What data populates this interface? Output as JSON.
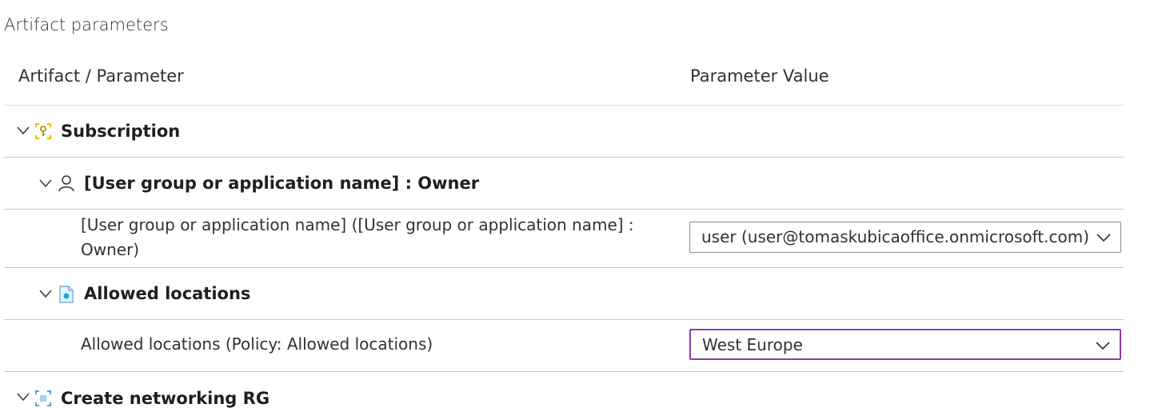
{
  "section": {
    "title": "Artifact parameters"
  },
  "table": {
    "col_artifact": "Artifact / Parameter",
    "col_value": "Parameter Value"
  },
  "groups": [
    {
      "label": "Subscription",
      "icon": "subscription-key-icon"
    },
    {
      "label": "[User group or application name] : Owner",
      "icon": "user-icon"
    },
    {
      "label": "Allowed locations",
      "icon": "policy-icon"
    },
    {
      "label": "Create networking RG",
      "icon": "resource-group-icon"
    }
  ],
  "params": [
    {
      "label": "[User group or application name] ([User group or application name] : Owner)",
      "value": "user (user@tomaskubicaoffice.onmicrosoft.com)"
    },
    {
      "label": "Allowed locations (Policy: Allowed locations)",
      "value": "West Europe"
    }
  ],
  "colors": {
    "accent_focus": "#8c3bb3",
    "subscription_icon": "#f2b700",
    "policy_icon": "#1ba1e2"
  }
}
